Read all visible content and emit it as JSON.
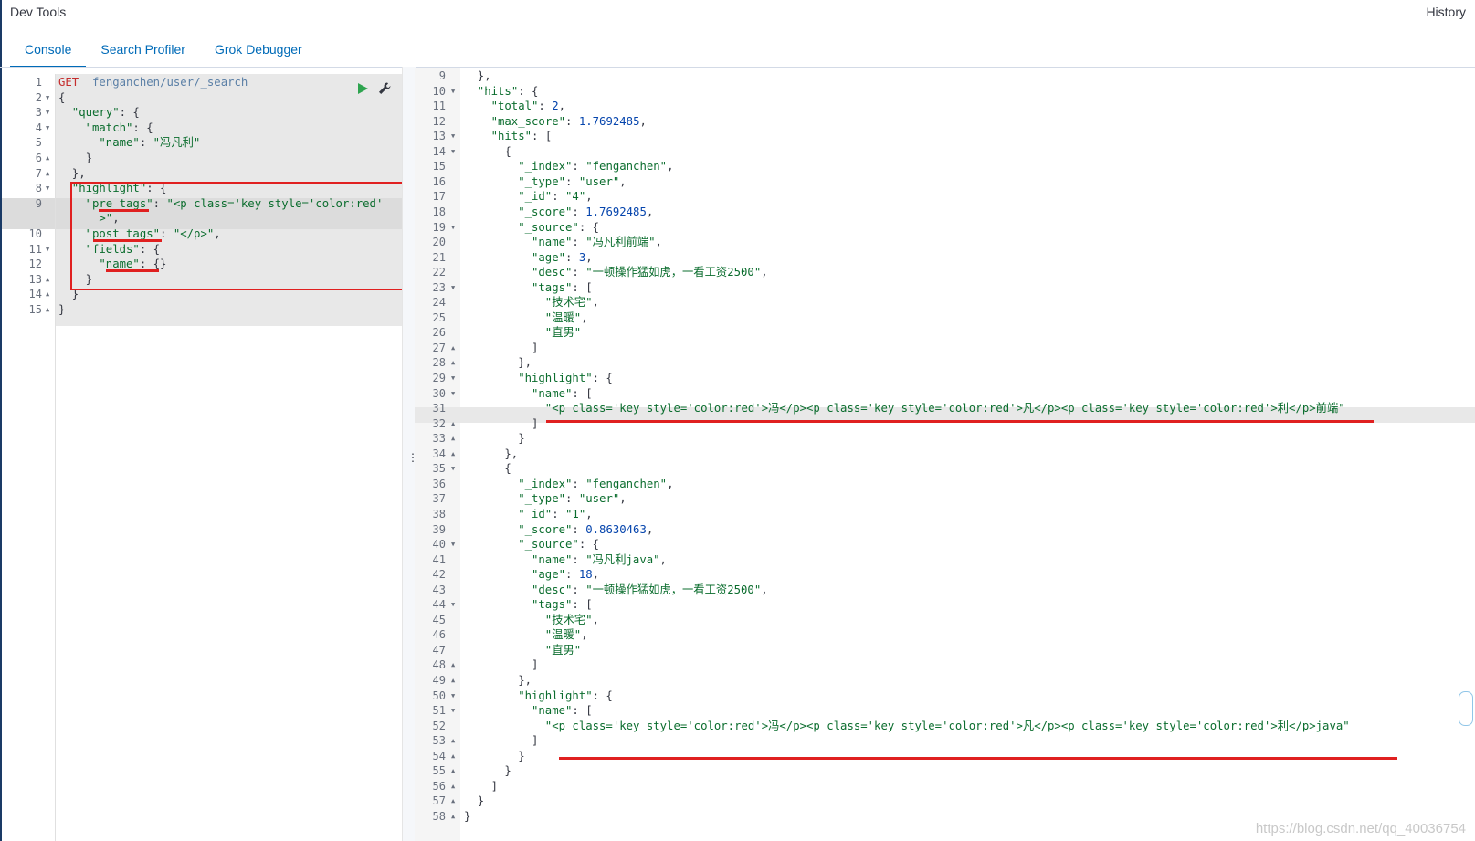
{
  "header": {
    "title": "Dev Tools",
    "history_label": "History"
  },
  "tabs": [
    {
      "label": "Console",
      "active": true
    },
    {
      "label": "Search Profiler",
      "active": false
    },
    {
      "label": "Grok Debugger",
      "active": false
    }
  ],
  "request": {
    "lines": [
      {
        "n": "1",
        "fold": "",
        "indent": 0,
        "parts": [
          [
            "method",
            "GET"
          ],
          [
            "",
            "  "
          ],
          [
            "url",
            "fenganchen/user/_search"
          ]
        ]
      },
      {
        "n": "2",
        "fold": "down",
        "indent": 0,
        "parts": [
          [
            "",
            "{"
          ]
        ]
      },
      {
        "n": "3",
        "fold": "down",
        "indent": 2,
        "parts": [
          [
            "key",
            "\"query\""
          ],
          [
            "",
            ": {"
          ]
        ]
      },
      {
        "n": "4",
        "fold": "down",
        "indent": 4,
        "parts": [
          [
            "key",
            "\"match\""
          ],
          [
            "",
            ": {"
          ]
        ]
      },
      {
        "n": "5",
        "fold": "",
        "indent": 6,
        "parts": [
          [
            "key",
            "\"name\""
          ],
          [
            "",
            ": "
          ],
          [
            "str",
            "\"冯凡利\""
          ]
        ]
      },
      {
        "n": "6",
        "fold": "up",
        "indent": 4,
        "parts": [
          [
            "",
            "}"
          ]
        ]
      },
      {
        "n": "7",
        "fold": "up",
        "indent": 2,
        "parts": [
          [
            "",
            "},"
          ]
        ]
      },
      {
        "n": "8",
        "fold": "down",
        "indent": 2,
        "parts": [
          [
            "key",
            "\"highlight\""
          ],
          [
            "",
            ": {"
          ]
        ]
      },
      {
        "n": "9",
        "fold": "",
        "indent": 4,
        "parts": [
          [
            "key",
            "\"pre_tags\""
          ],
          [
            "",
            ": "
          ],
          [
            "str",
            "\"<p class='key style='color:red'"
          ]
        ]
      },
      {
        "n": "",
        "fold": "",
        "indent": 6,
        "parts": [
          [
            "str",
            ">\""
          ],
          [
            "",
            ","
          ]
        ]
      },
      {
        "n": "10",
        "fold": "",
        "indent": 4,
        "parts": [
          [
            "key",
            "\"post_tags\""
          ],
          [
            "",
            ": "
          ],
          [
            "str",
            "\"</p>\""
          ],
          [
            "",
            ","
          ]
        ]
      },
      {
        "n": "11",
        "fold": "down",
        "indent": 4,
        "parts": [
          [
            "key",
            "\"fields\""
          ],
          [
            "",
            ": {"
          ]
        ]
      },
      {
        "n": "12",
        "fold": "",
        "indent": 6,
        "parts": [
          [
            "key",
            "\"name\""
          ],
          [
            "",
            ": {}"
          ]
        ]
      },
      {
        "n": "13",
        "fold": "up",
        "indent": 4,
        "parts": [
          [
            "",
            "}"
          ]
        ]
      },
      {
        "n": "14",
        "fold": "up",
        "indent": 2,
        "parts": [
          [
            "",
            "}"
          ]
        ]
      },
      {
        "n": "15",
        "fold": "up",
        "indent": 0,
        "parts": [
          [
            "",
            "}"
          ]
        ]
      }
    ]
  },
  "response": {
    "lines": [
      {
        "n": "9",
        "fold": "",
        "indent": 2,
        "parts": [
          [
            "",
            "},"
          ]
        ]
      },
      {
        "n": "10",
        "fold": "down",
        "indent": 2,
        "parts": [
          [
            "key",
            "\"hits\""
          ],
          [
            "",
            ": {"
          ]
        ]
      },
      {
        "n": "11",
        "fold": "",
        "indent": 4,
        "parts": [
          [
            "key",
            "\"total\""
          ],
          [
            "",
            ": "
          ],
          [
            "num",
            "2"
          ],
          [
            "",
            ","
          ]
        ]
      },
      {
        "n": "12",
        "fold": "",
        "indent": 4,
        "parts": [
          [
            "key",
            "\"max_score\""
          ],
          [
            "",
            ": "
          ],
          [
            "num",
            "1.7692485"
          ],
          [
            "",
            ","
          ]
        ]
      },
      {
        "n": "13",
        "fold": "down",
        "indent": 4,
        "parts": [
          [
            "key",
            "\"hits\""
          ],
          [
            "",
            ": ["
          ]
        ]
      },
      {
        "n": "14",
        "fold": "down",
        "indent": 6,
        "parts": [
          [
            "",
            "{"
          ]
        ]
      },
      {
        "n": "15",
        "fold": "",
        "indent": 8,
        "parts": [
          [
            "key",
            "\"_index\""
          ],
          [
            "",
            ": "
          ],
          [
            "str",
            "\"fenganchen\""
          ],
          [
            "",
            ","
          ]
        ]
      },
      {
        "n": "16",
        "fold": "",
        "indent": 8,
        "parts": [
          [
            "key",
            "\"_type\""
          ],
          [
            "",
            ": "
          ],
          [
            "str",
            "\"user\""
          ],
          [
            "",
            ","
          ]
        ]
      },
      {
        "n": "17",
        "fold": "",
        "indent": 8,
        "parts": [
          [
            "key",
            "\"_id\""
          ],
          [
            "",
            ": "
          ],
          [
            "str",
            "\"4\""
          ],
          [
            "",
            ","
          ]
        ]
      },
      {
        "n": "18",
        "fold": "",
        "indent": 8,
        "parts": [
          [
            "key",
            "\"_score\""
          ],
          [
            "",
            ": "
          ],
          [
            "num",
            "1.7692485"
          ],
          [
            "",
            ","
          ]
        ]
      },
      {
        "n": "19",
        "fold": "down",
        "indent": 8,
        "parts": [
          [
            "key",
            "\"_source\""
          ],
          [
            "",
            ": {"
          ]
        ]
      },
      {
        "n": "20",
        "fold": "",
        "indent": 10,
        "parts": [
          [
            "key",
            "\"name\""
          ],
          [
            "",
            ": "
          ],
          [
            "str",
            "\"冯凡利前端\""
          ],
          [
            "",
            ","
          ]
        ]
      },
      {
        "n": "21",
        "fold": "",
        "indent": 10,
        "parts": [
          [
            "key",
            "\"age\""
          ],
          [
            "",
            ": "
          ],
          [
            "num",
            "3"
          ],
          [
            "",
            ","
          ]
        ]
      },
      {
        "n": "22",
        "fold": "",
        "indent": 10,
        "parts": [
          [
            "key",
            "\"desc\""
          ],
          [
            "",
            ": "
          ],
          [
            "str",
            "\"一顿操作猛如虎，一看工资2500\""
          ],
          [
            "",
            ","
          ]
        ]
      },
      {
        "n": "23",
        "fold": "down",
        "indent": 10,
        "parts": [
          [
            "key",
            "\"tags\""
          ],
          [
            "",
            ": ["
          ]
        ]
      },
      {
        "n": "24",
        "fold": "",
        "indent": 12,
        "parts": [
          [
            "str",
            "\"技术宅\""
          ],
          [
            "",
            ","
          ]
        ]
      },
      {
        "n": "25",
        "fold": "",
        "indent": 12,
        "parts": [
          [
            "str",
            "\"温暖\""
          ],
          [
            "",
            ","
          ]
        ]
      },
      {
        "n": "26",
        "fold": "",
        "indent": 12,
        "parts": [
          [
            "str",
            "\"直男\""
          ]
        ]
      },
      {
        "n": "27",
        "fold": "up",
        "indent": 10,
        "parts": [
          [
            "",
            "]"
          ]
        ]
      },
      {
        "n": "28",
        "fold": "up",
        "indent": 8,
        "parts": [
          [
            "",
            "},"
          ]
        ]
      },
      {
        "n": "29",
        "fold": "down",
        "indent": 8,
        "parts": [
          [
            "key",
            "\"highlight\""
          ],
          [
            "",
            ": {"
          ]
        ]
      },
      {
        "n": "30",
        "fold": "down",
        "indent": 10,
        "parts": [
          [
            "key",
            "\"name\""
          ],
          [
            "",
            ": ["
          ]
        ]
      },
      {
        "n": "31",
        "fold": "",
        "indent": 12,
        "parts": [
          [
            "str",
            "\"<p class='key style='color:red'>冯</p><p class='key style='color:red'>凡</p><p class='key style='color:red'>利</p>前端\""
          ]
        ]
      },
      {
        "n": "32",
        "fold": "up",
        "indent": 10,
        "parts": [
          [
            "",
            "]"
          ]
        ]
      },
      {
        "n": "33",
        "fold": "up",
        "indent": 8,
        "parts": [
          [
            "",
            "}"
          ]
        ]
      },
      {
        "n": "34",
        "fold": "up",
        "indent": 6,
        "parts": [
          [
            "",
            "},"
          ]
        ]
      },
      {
        "n": "35",
        "fold": "down",
        "indent": 6,
        "parts": [
          [
            "",
            "{"
          ]
        ]
      },
      {
        "n": "36",
        "fold": "",
        "indent": 8,
        "parts": [
          [
            "key",
            "\"_index\""
          ],
          [
            "",
            ": "
          ],
          [
            "str",
            "\"fenganchen\""
          ],
          [
            "",
            ","
          ]
        ]
      },
      {
        "n": "37",
        "fold": "",
        "indent": 8,
        "parts": [
          [
            "key",
            "\"_type\""
          ],
          [
            "",
            ": "
          ],
          [
            "str",
            "\"user\""
          ],
          [
            "",
            ","
          ]
        ]
      },
      {
        "n": "38",
        "fold": "",
        "indent": 8,
        "parts": [
          [
            "key",
            "\"_id\""
          ],
          [
            "",
            ": "
          ],
          [
            "str",
            "\"1\""
          ],
          [
            "",
            ","
          ]
        ]
      },
      {
        "n": "39",
        "fold": "",
        "indent": 8,
        "parts": [
          [
            "key",
            "\"_score\""
          ],
          [
            "",
            ": "
          ],
          [
            "num",
            "0.8630463"
          ],
          [
            "",
            ","
          ]
        ]
      },
      {
        "n": "40",
        "fold": "down",
        "indent": 8,
        "parts": [
          [
            "key",
            "\"_source\""
          ],
          [
            "",
            ": {"
          ]
        ]
      },
      {
        "n": "41",
        "fold": "",
        "indent": 10,
        "parts": [
          [
            "key",
            "\"name\""
          ],
          [
            "",
            ": "
          ],
          [
            "str",
            "\"冯凡利java\""
          ],
          [
            "",
            ","
          ]
        ]
      },
      {
        "n": "42",
        "fold": "",
        "indent": 10,
        "parts": [
          [
            "key",
            "\"age\""
          ],
          [
            "",
            ": "
          ],
          [
            "num",
            "18"
          ],
          [
            "",
            ","
          ]
        ]
      },
      {
        "n": "43",
        "fold": "",
        "indent": 10,
        "parts": [
          [
            "key",
            "\"desc\""
          ],
          [
            "",
            ": "
          ],
          [
            "str",
            "\"一顿操作猛如虎，一看工资2500\""
          ],
          [
            "",
            ","
          ]
        ]
      },
      {
        "n": "44",
        "fold": "down",
        "indent": 10,
        "parts": [
          [
            "key",
            "\"tags\""
          ],
          [
            "",
            ": ["
          ]
        ]
      },
      {
        "n": "45",
        "fold": "",
        "indent": 12,
        "parts": [
          [
            "str",
            "\"技术宅\""
          ],
          [
            "",
            ","
          ]
        ]
      },
      {
        "n": "46",
        "fold": "",
        "indent": 12,
        "parts": [
          [
            "str",
            "\"温暖\""
          ],
          [
            "",
            ","
          ]
        ]
      },
      {
        "n": "47",
        "fold": "",
        "indent": 12,
        "parts": [
          [
            "str",
            "\"直男\""
          ]
        ]
      },
      {
        "n": "48",
        "fold": "up",
        "indent": 10,
        "parts": [
          [
            "",
            "]"
          ]
        ]
      },
      {
        "n": "49",
        "fold": "up",
        "indent": 8,
        "parts": [
          [
            "",
            "},"
          ]
        ]
      },
      {
        "n": "50",
        "fold": "down",
        "indent": 8,
        "parts": [
          [
            "key",
            "\"highlight\""
          ],
          [
            "",
            ": {"
          ]
        ]
      },
      {
        "n": "51",
        "fold": "down",
        "indent": 10,
        "parts": [
          [
            "key",
            "\"name\""
          ],
          [
            "",
            ": ["
          ]
        ]
      },
      {
        "n": "52",
        "fold": "",
        "indent": 12,
        "parts": [
          [
            "str",
            "\"<p class='key style='color:red'>冯</p><p class='key style='color:red'>凡</p><p class='key style='color:red'>利</p>java\""
          ]
        ]
      },
      {
        "n": "53",
        "fold": "up",
        "indent": 10,
        "parts": [
          [
            "",
            "]"
          ]
        ]
      },
      {
        "n": "54",
        "fold": "up",
        "indent": 8,
        "parts": [
          [
            "",
            "}"
          ]
        ]
      },
      {
        "n": "55",
        "fold": "up",
        "indent": 6,
        "parts": [
          [
            "",
            "}"
          ]
        ]
      },
      {
        "n": "56",
        "fold": "up",
        "indent": 4,
        "parts": [
          [
            "",
            "]"
          ]
        ]
      },
      {
        "n": "57",
        "fold": "up",
        "indent": 2,
        "parts": [
          [
            "",
            "}"
          ]
        ]
      },
      {
        "n": "58",
        "fold": "up",
        "indent": 0,
        "parts": [
          [
            "",
            "}"
          ]
        ]
      }
    ]
  },
  "watermark": "https://blog.csdn.net/qq_40036754",
  "colors": {
    "accent": "#006bb8",
    "annotation_red": "#e02020"
  }
}
